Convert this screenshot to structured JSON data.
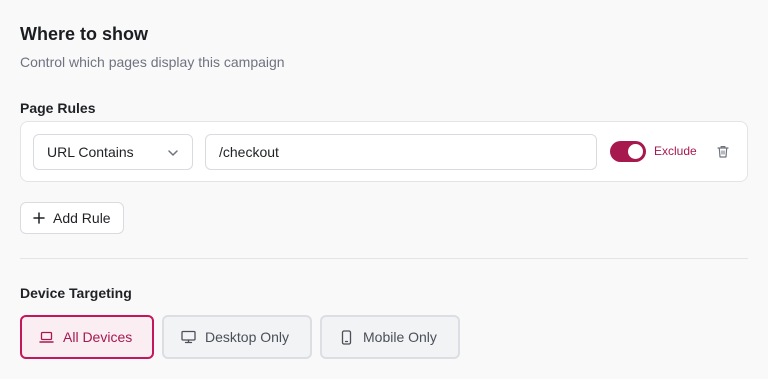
{
  "header": {
    "title": "Where to show",
    "subtitle": "Control which pages display this campaign"
  },
  "page_rules": {
    "label": "Page Rules",
    "rules": [
      {
        "match_type": "URL Contains",
        "value": "/checkout",
        "exclude_enabled": true,
        "exclude_label": "Exclude"
      }
    ],
    "add_rule_label": "Add Rule"
  },
  "device_targeting": {
    "label": "Device Targeting",
    "options": [
      {
        "label": "All Devices",
        "icon": "laptop-icon",
        "selected": true
      },
      {
        "label": "Desktop Only",
        "icon": "monitor-icon",
        "selected": false
      },
      {
        "label": "Mobile Only",
        "icon": "smartphone-icon",
        "selected": false
      }
    ]
  },
  "colors": {
    "accent": "#a7184f",
    "accent_border": "#c2185b",
    "selected_bg": "#fbeef3",
    "page_bg": "#f9f9fa"
  }
}
